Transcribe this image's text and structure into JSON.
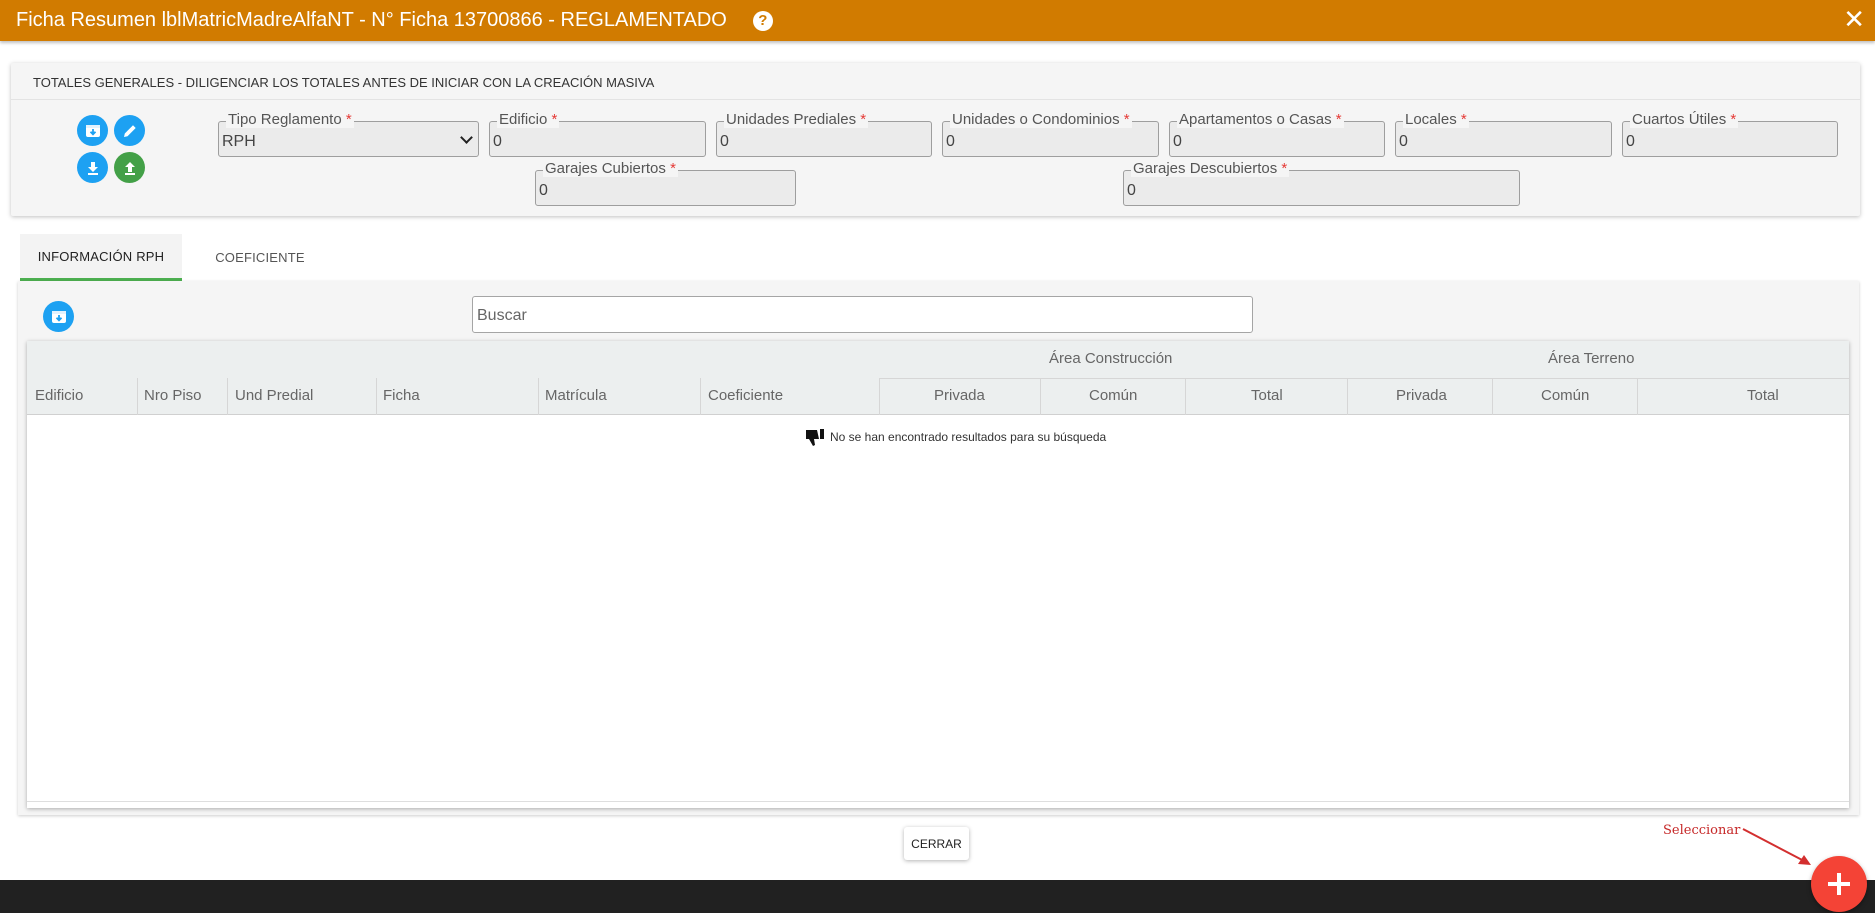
{
  "window": {
    "title": "Ficha Resumen lblMatricMadreAlfaNT - N° Ficha 13700866 - REGLAMENTADO",
    "help_glyph": "?",
    "close_glyph": "✕"
  },
  "totals": {
    "header": "TOTALES GENERALES - DILIGENCIAR LOS TOTALES ANTES DE INICIAR CON LA CREACIÓN MASIVA",
    "required_mark": "*",
    "fields": {
      "tipo_reglamento": {
        "label": "Tipo Reglamento",
        "value": "RPH"
      },
      "edificio": {
        "label": "Edificio",
        "value": "0"
      },
      "unidades_prediales": {
        "label": "Unidades Prediales",
        "value": "0"
      },
      "unidades_condominios": {
        "label": "Unidades o Condominios",
        "value": "0"
      },
      "apartamentos_casas": {
        "label": "Apartamentos o Casas",
        "value": "0"
      },
      "locales": {
        "label": "Locales",
        "value": "0"
      },
      "cuartos_utiles": {
        "label": "Cuartos Útiles",
        "value": "0"
      },
      "garajes_cubiertos": {
        "label": "Garajes Cubiertos",
        "value": "0"
      },
      "garajes_descubiertos": {
        "label": "Garajes Descubiertos",
        "value": "0"
      }
    }
  },
  "tabs": [
    {
      "label": "INFORMACIÓN RPH",
      "active": true
    },
    {
      "label": "COEFICIENTE",
      "active": false
    }
  ],
  "search": {
    "placeholder": "Buscar"
  },
  "table": {
    "groups": {
      "construccion": "Área Construcción",
      "terreno": "Área Terreno"
    },
    "columns": [
      "Edificio",
      "Nro Piso",
      "Und Predial",
      "Ficha",
      "Matrícula",
      "Coeficiente",
      "Privada",
      "Común",
      "Total",
      "Privada",
      "Común",
      "Total"
    ],
    "empty_message": "No se han encontrado resultados para su búsqueda"
  },
  "footer": {
    "close_label": "CERRAR"
  },
  "annotation": {
    "text": "Seleccionar"
  },
  "fab": {
    "glyph": "+"
  },
  "colors": {
    "header": "#d17b00",
    "primary_blue": "#1da1f2",
    "success_green": "#43a047",
    "tab_indicator": "#4caf50",
    "fab_red": "#f44336",
    "required": "#e53935"
  }
}
